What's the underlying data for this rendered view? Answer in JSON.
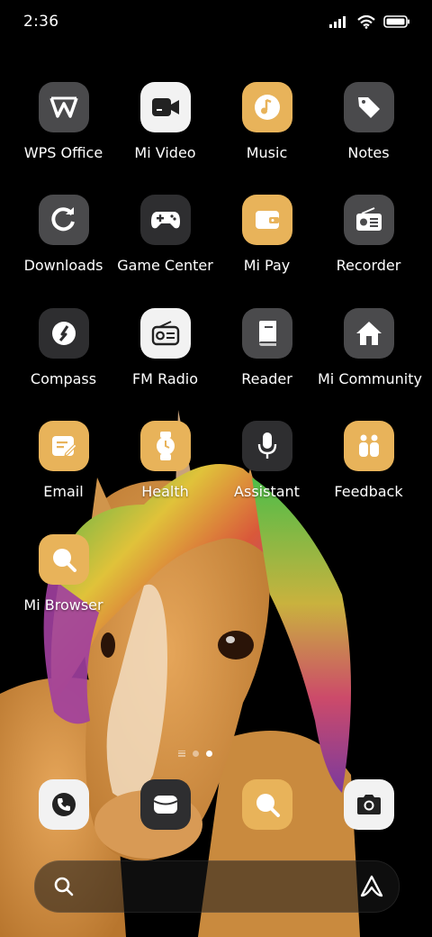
{
  "status_bar": {
    "time": "2:36",
    "icons": [
      "signal-icon",
      "wifi-icon",
      "battery-icon"
    ]
  },
  "apps": [
    {
      "label": "WPS Office",
      "icon": "wps-office-icon",
      "style": "gray"
    },
    {
      "label": "Mi Video",
      "icon": "video-camera-icon",
      "style": "white"
    },
    {
      "label": "Music",
      "icon": "music-note-icon",
      "style": "orange"
    },
    {
      "label": "Notes",
      "icon": "tag-icon",
      "style": "gray"
    },
    {
      "label": "Downloads",
      "icon": "download-arrow-icon",
      "style": "gray"
    },
    {
      "label": "Game Center",
      "icon": "gamepad-icon",
      "style": "dark"
    },
    {
      "label": "Mi Pay",
      "icon": "wallet-icon",
      "style": "orange"
    },
    {
      "label": "Recorder",
      "icon": "radio-recorder-icon",
      "style": "gray"
    },
    {
      "label": "Compass",
      "icon": "compass-icon",
      "style": "dark"
    },
    {
      "label": "FM Radio",
      "icon": "radio-icon",
      "style": "white"
    },
    {
      "label": "Reader",
      "icon": "book-icon",
      "style": "gray"
    },
    {
      "label": "Mi Community",
      "icon": "home-icon",
      "style": "gray"
    },
    {
      "label": "Email",
      "icon": "email-edit-icon",
      "style": "orange"
    },
    {
      "label": "Health",
      "icon": "watch-icon",
      "style": "orange"
    },
    {
      "label": "Assistant",
      "icon": "microphone-icon",
      "style": "dark"
    },
    {
      "label": "Feedback",
      "icon": "feedback-icon",
      "style": "orange"
    },
    {
      "label": "Mi Browser",
      "icon": "search-magnifier-icon",
      "style": "orange"
    }
  ],
  "page_indicator": {
    "pages": 2,
    "active": 2
  },
  "dock": [
    {
      "name": "phone",
      "icon": "phone-icon",
      "style": "white"
    },
    {
      "name": "messages",
      "icon": "message-icon",
      "style": "dark"
    },
    {
      "name": "browser",
      "icon": "search-magnifier-icon",
      "style": "orange"
    },
    {
      "name": "camera",
      "icon": "camera-icon",
      "style": "white"
    }
  ],
  "search_bar": {
    "left_icon": "search-icon",
    "right_icon": "assistant-a-icon"
  },
  "colors": {
    "orange_tile": "#e8b35a",
    "gray_tile": "#4a4a4c",
    "dark_tile": "#2e2e30",
    "white_tile": "#f2f2f2",
    "background": "#000000"
  }
}
